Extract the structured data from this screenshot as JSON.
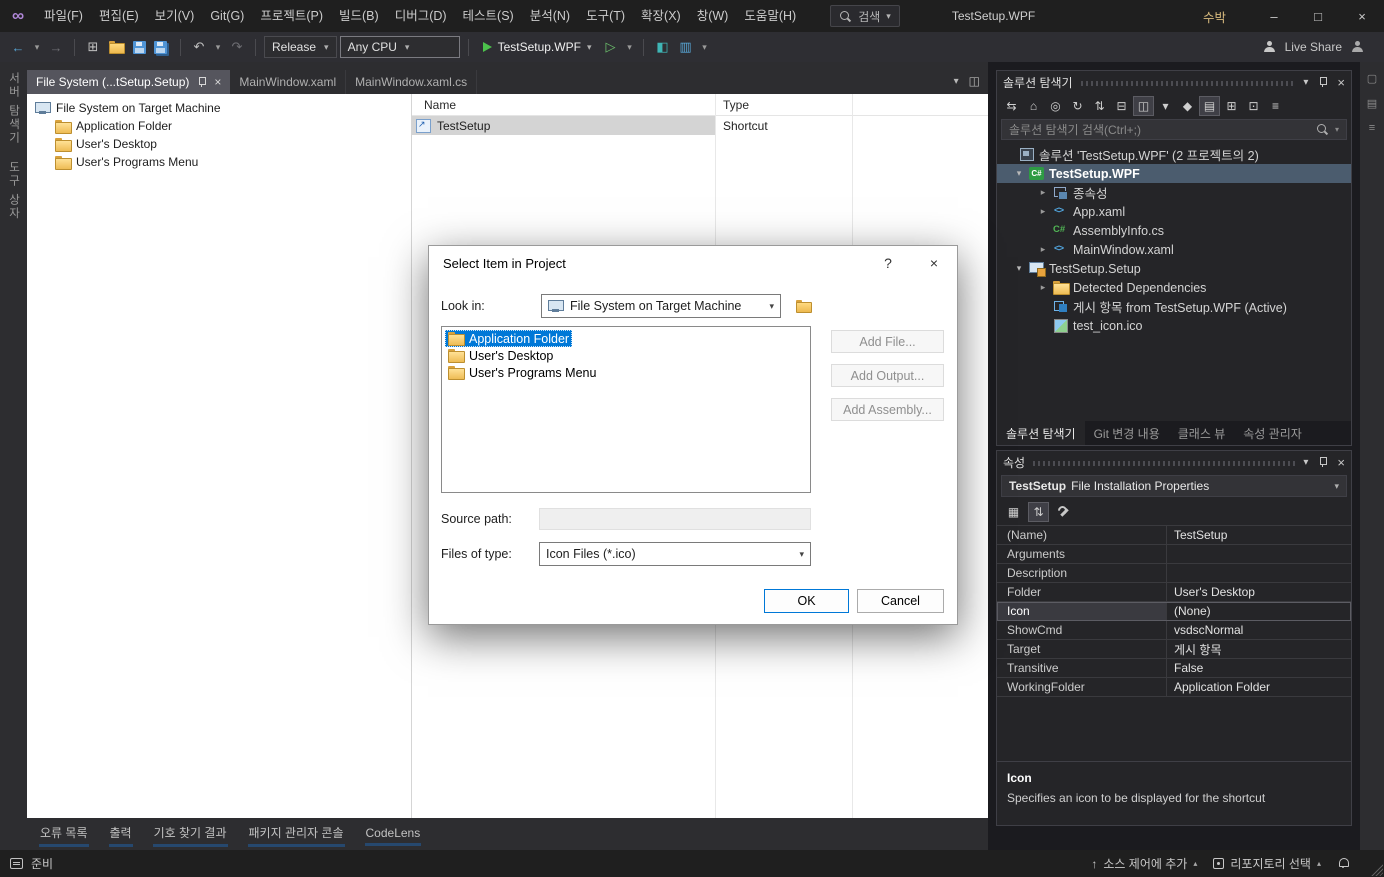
{
  "colors": {
    "accent": "#007acc",
    "selection_blue": "#0078d7",
    "titlebar_bg": "#1f1f1f",
    "panel_bg": "#252528",
    "editor_bg": "#ffffff",
    "folder_yellow": "#edb94f",
    "run_green": "#4cc24c",
    "account_yellow": "#d7ba7d",
    "tree_selection": "#4b5c6e"
  },
  "icons": {
    "logo": "∞",
    "back": "←",
    "forward": "→",
    "chevron_down": "▾",
    "undo": "↶",
    "redo": "↷",
    "play_outline": "▷",
    "compare": "◧",
    "layout": "▥",
    "new_project": "⊞",
    "minimize": "–",
    "maximize": "□",
    "close": "×",
    "tab_close": "×",
    "help": "?",
    "caret_up": "▴",
    "up_arrow": "↑",
    "window_float": "◫"
  },
  "titlebar": {
    "menus": [
      "파일(F)",
      "편집(E)",
      "보기(V)",
      "Git(G)",
      "프로젝트(P)",
      "빌드(B)",
      "디버그(D)",
      "테스트(S)",
      "분석(N)",
      "도구(T)",
      "확장(X)",
      "창(W)",
      "도움말(H)"
    ],
    "search_label": "검색",
    "window_title": "TestSetup.WPF",
    "account_name": "수박"
  },
  "toolbar": {
    "config": "Release",
    "platform": "Any CPU",
    "run_target": "TestSetup.WPF",
    "live_share": "Live Share"
  },
  "left_dock_tabs": [
    "서버 탐색기",
    "도구 상자"
  ],
  "editor": {
    "tabs": [
      {
        "label": "File System (...tSetup.Setup)",
        "active": true
      },
      {
        "label": "MainWindow.xaml",
        "active": false
      },
      {
        "label": "MainWindow.xaml.cs",
        "active": false
      }
    ],
    "file_tree": [
      {
        "label": "File System on Target Machine",
        "icon": "machine",
        "level": 0
      },
      {
        "label": "Application Folder",
        "icon": "folder",
        "level": 1
      },
      {
        "label": "User's Desktop",
        "icon": "folder",
        "level": 1
      },
      {
        "label": "User's Programs Menu",
        "icon": "folder",
        "level": 1
      }
    ],
    "columns": {
      "name": "Name",
      "type": "Type"
    },
    "rows": [
      {
        "name": "TestSetup",
        "type": "Shortcut",
        "icon": "shortcut",
        "selected": true
      }
    ]
  },
  "dialog": {
    "title": "Select Item in Project",
    "look_in_label": "Look in:",
    "look_in_value": "File System on Target Machine",
    "items": [
      {
        "label": "Application Folder",
        "selected": true
      },
      {
        "label": "User's Desktop",
        "selected": false
      },
      {
        "label": "User's Programs Menu",
        "selected": false
      }
    ],
    "side_buttons": [
      "Add File...",
      "Add Output...",
      "Add Assembly..."
    ],
    "source_path_label": "Source path:",
    "source_path_value": "",
    "files_of_type_label": "Files of type:",
    "files_of_type_value": "Icon Files (*.ico)",
    "ok_label": "OK",
    "cancel_label": "Cancel"
  },
  "solution_explorer": {
    "title": "솔루션 탐색기",
    "search_placeholder": "솔루션 탐색기 검색(Ctrl+;)",
    "toolbar_icons": [
      {
        "name": "switch-views-icon",
        "glyph": "⇆"
      },
      {
        "name": "home-icon",
        "glyph": "⌂"
      },
      {
        "name": "pending-changes-filter-icon",
        "glyph": "◎"
      },
      {
        "name": "refresh-icon",
        "glyph": "↻"
      },
      {
        "name": "nest-files-icon",
        "glyph": "⇅"
      },
      {
        "name": "collapse-all-icon",
        "glyph": "⊟"
      },
      {
        "name": "show-all-files-icon",
        "glyph": "◫",
        "toggled": true
      },
      {
        "name": "view-dropdown-icon",
        "glyph": "▾"
      },
      {
        "name": "properties-icon",
        "glyph": "◆"
      },
      {
        "name": "preview-selected-icon",
        "glyph": "▤",
        "toggled": true
      },
      {
        "name": "add-item-icon",
        "glyph": "⊞"
      },
      {
        "name": "add-folder-icon",
        "glyph": "⊡"
      },
      {
        "name": "more-icon",
        "glyph": "≡"
      }
    ],
    "tree": [
      {
        "label": "솔루션 'TestSetup.WPF' (2 프로젝트의 2)",
        "icon": "solution",
        "level": 0
      },
      {
        "label": "TestSetup.WPF",
        "icon": "csproj",
        "level": 1,
        "expand": "down",
        "bold": true,
        "selected": true
      },
      {
        "label": "종속성",
        "icon": "deps",
        "level": 2,
        "expand": "right"
      },
      {
        "label": "App.xaml",
        "icon": "xaml",
        "level": 2,
        "expand": "right"
      },
      {
        "label": "AssemblyInfo.cs",
        "icon": "cs",
        "level": 2
      },
      {
        "label": "MainWindow.xaml",
        "icon": "xaml",
        "level": 2,
        "expand": "right"
      },
      {
        "label": "TestSetup.Setup",
        "icon": "setup",
        "level": 1,
        "expand": "down"
      },
      {
        "label": "Detected Dependencies",
        "icon": "folder",
        "level": 2,
        "expand": "right"
      },
      {
        "label": "게시 항목 from TestSetup.WPF (Active)",
        "icon": "publish",
        "level": 2
      },
      {
        "label": "test_icon.ico",
        "icon": "ico",
        "level": 2
      }
    ],
    "bottom_tabs": [
      {
        "label": "솔루션 탐색기",
        "active": true
      },
      {
        "label": "Git 변경 내용",
        "active": false
      },
      {
        "label": "클래스 뷰",
        "active": false
      },
      {
        "label": "속성 관리자",
        "active": false
      }
    ]
  },
  "properties_panel": {
    "title": "속성",
    "object_name": "TestSetup",
    "object_type": "File Installation Properties",
    "rows": [
      {
        "name": "(Name)",
        "value": "TestSetup",
        "selected": false
      },
      {
        "name": "Arguments",
        "value": "",
        "selected": false
      },
      {
        "name": "Description",
        "value": "",
        "selected": false
      },
      {
        "name": "Folder",
        "value": "User's Desktop",
        "selected": false
      },
      {
        "name": "Icon",
        "value": "(None)",
        "selected": true
      },
      {
        "name": "ShowCmd",
        "value": "vsdscNormal",
        "selected": false
      },
      {
        "name": "Target",
        "value": "게시 항목",
        "selected": false
      },
      {
        "name": "Transitive",
        "value": "False",
        "selected": false
      },
      {
        "name": "WorkingFolder",
        "value": "Application Folder",
        "selected": false
      }
    ],
    "description_title": "Icon",
    "description_text": "Specifies an icon to be displayed for the shortcut"
  },
  "bottom_panel_tabs": [
    "오류 목록",
    "출력",
    "기호 찾기 결과",
    "패키지 관리자 콘솔",
    "CodeLens"
  ],
  "right_strip_icons": [
    {
      "name": "properties-window-icon",
      "glyph": "▢"
    },
    {
      "name": "task-list-icon",
      "glyph": "▤"
    },
    {
      "name": "resources-view-icon",
      "glyph": "≡"
    }
  ],
  "statusbar": {
    "ready_label": "준비",
    "add_to_source_label": "소스 제어에 추가",
    "select_repo_label": "리포지토리 선택"
  }
}
